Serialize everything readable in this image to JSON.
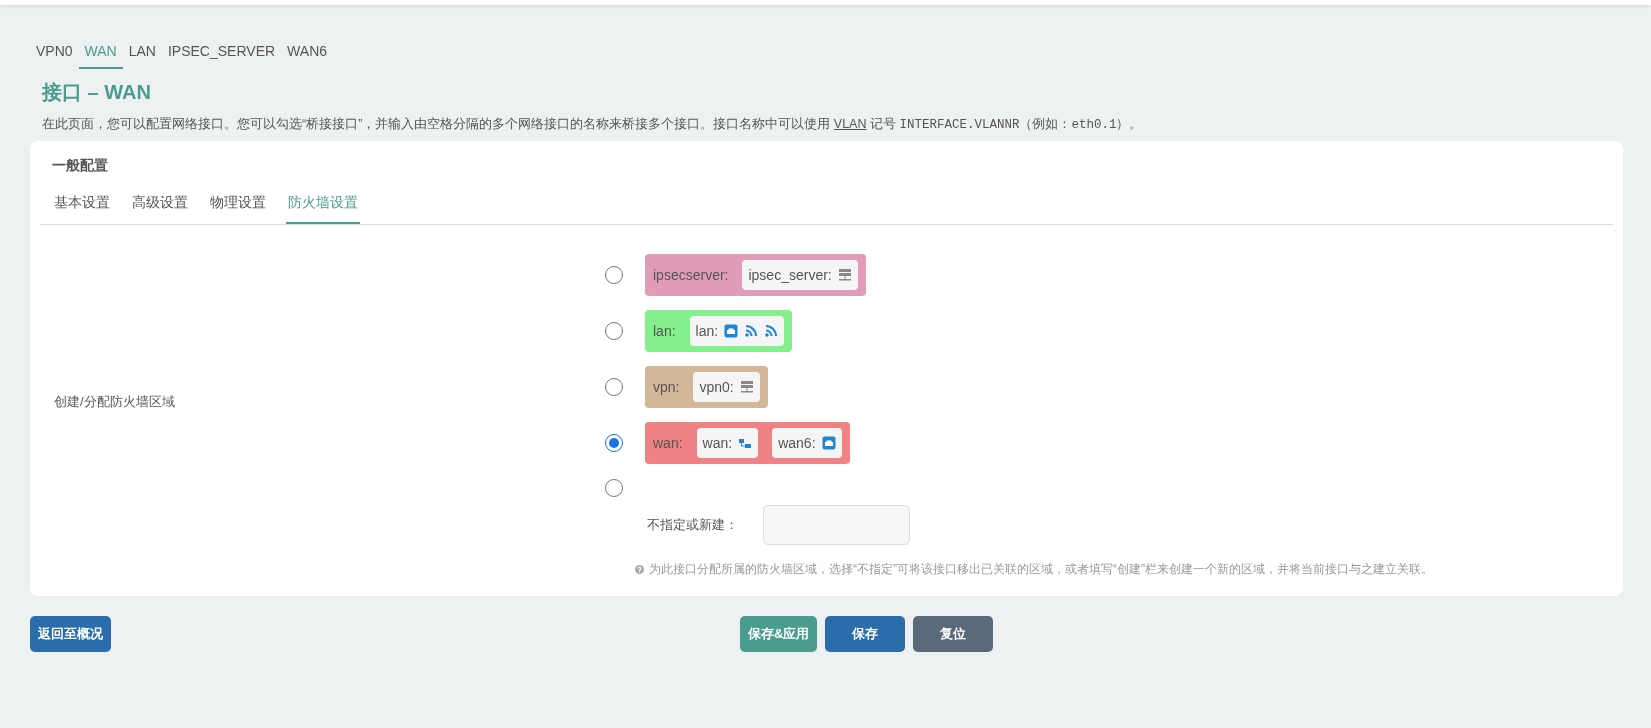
{
  "interface_tabs": [
    {
      "label": "VPN0",
      "selected": false
    },
    {
      "label": "WAN",
      "selected": true
    },
    {
      "label": "LAN",
      "selected": false
    },
    {
      "label": "IPSEC_SERVER",
      "selected": false
    },
    {
      "label": "WAN6",
      "selected": false
    }
  ],
  "title": "接口 – WAN",
  "description": [
    {
      "kind": "text",
      "text": "在此页面，您可以配置网络接口。您可以勾选“桥接接口”，并输入由空格分隔的多个网络接口的名称来桥接多个接口。接口名称中可以使用 "
    },
    {
      "kind": "link",
      "text": "VLAN"
    },
    {
      "kind": "text",
      "text": " 记号 "
    },
    {
      "kind": "code",
      "text": "INTERFACE.VLANNR"
    },
    {
      "kind": "text",
      "text": "（例如："
    },
    {
      "kind": "code",
      "text": "eth0.1"
    },
    {
      "kind": "text",
      "text": "）。"
    }
  ],
  "section": {
    "title": "一般配置",
    "tabs": [
      {
        "label": "基本设置",
        "selected": false
      },
      {
        "label": "高级设置",
        "selected": false
      },
      {
        "label": "物理设置",
        "selected": false
      },
      {
        "label": "防火墙设置",
        "selected": true
      }
    ],
    "field_label": "创建/分配防火墙区域",
    "zones": [
      {
        "name": "ipsecserver:",
        "color": "#e19cb8",
        "selected": false,
        "networks": [
          {
            "name": "ipsec_server:",
            "devices": [
              {
                "kind": "server"
              }
            ]
          }
        ]
      },
      {
        "name": "lan:",
        "color": "#84f08b",
        "selected": false,
        "networks": [
          {
            "name": "lan:",
            "devices": [
              {
                "kind": "ethernet"
              },
              {
                "kind": "wifi"
              },
              {
                "kind": "wifi"
              }
            ]
          }
        ]
      },
      {
        "name": "vpn:",
        "color": "#d2b898",
        "selected": false,
        "networks": [
          {
            "name": "vpn0:",
            "devices": [
              {
                "kind": "server"
              }
            ]
          }
        ]
      },
      {
        "name": "wan:",
        "color": "#f08285",
        "selected": true,
        "networks": [
          {
            "name": "wan:",
            "devices": [
              {
                "kind": "switch"
              }
            ]
          },
          {
            "name": "wan6:",
            "devices": [
              {
                "kind": "ethernet"
              }
            ]
          }
        ]
      }
    ],
    "new_zone": {
      "selected": false,
      "label": "不指定或新建："
    },
    "help": "为此接口分配所属的防火墙区域，选择“不指定”可将该接口移出已关联的区域，或者填写“创建”栏来创建一个新的区域，并将当前接口与之建立关联。"
  },
  "buttons": [
    {
      "kind": "back",
      "label": "返回至概况"
    },
    {
      "kind": "apply",
      "label": "保存&应用"
    },
    {
      "kind": "save",
      "label": "保存"
    },
    {
      "kind": "reset",
      "label": "复位"
    }
  ]
}
